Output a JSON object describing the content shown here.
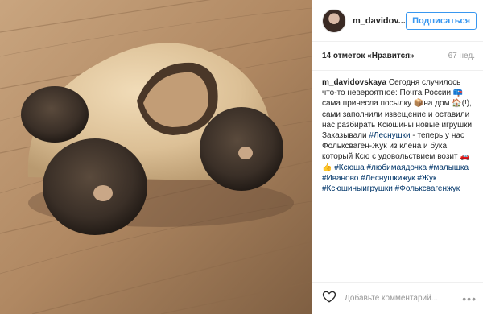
{
  "post": {
    "image_alt": "wooden toy car",
    "username": "m_davidov...",
    "follow_label": "Подписаться",
    "likes": "14 отметок «Нравится»",
    "time": "67 нед.",
    "caption": {
      "author": "m_davidovskaya",
      "parts": [
        {
          "type": "text",
          "value": " Сегодня случилось что-то невероятное: Почта России "
        },
        {
          "type": "emoji",
          "value": "📪"
        },
        {
          "type": "text",
          "value": "сама принесла посылку "
        },
        {
          "type": "emoji",
          "value": "📦"
        },
        {
          "type": "text",
          "value": "на дом "
        },
        {
          "type": "emoji",
          "value": "🏠"
        },
        {
          "type": "text",
          "value": "(!), сами заполнили извещение и оставили нас разбирать Ксюшины новые игрушки. Заказывали "
        },
        {
          "type": "tag",
          "value": "#Леснушки"
        },
        {
          "type": "text",
          "value": " - теперь у нас Фольксваген-Жук из клена и бука, который Ксю с удовольствием возит "
        },
        {
          "type": "emoji",
          "value": "🚗"
        },
        {
          "type": "text",
          "value": " "
        },
        {
          "type": "emoji",
          "value": "👍"
        },
        {
          "type": "text",
          "value": " "
        },
        {
          "type": "tag",
          "value": "#Ксюша"
        },
        {
          "type": "text",
          "value": " "
        },
        {
          "type": "tag",
          "value": "#любимаядочка"
        },
        {
          "type": "text",
          "value": " "
        },
        {
          "type": "tag",
          "value": "#малышка"
        },
        {
          "type": "text",
          "value": " "
        },
        {
          "type": "tag",
          "value": "#Иваново"
        },
        {
          "type": "text",
          "value": " "
        },
        {
          "type": "tag",
          "value": "#Леснушкижук"
        },
        {
          "type": "text",
          "value": " "
        },
        {
          "type": "tag",
          "value": "#Жук"
        },
        {
          "type": "text",
          "value": " "
        },
        {
          "type": "tag",
          "value": "#Ксюшиныигрушки"
        },
        {
          "type": "text",
          "value": " "
        },
        {
          "type": "tag",
          "value": "#Фольксвагенжук"
        }
      ]
    },
    "comment_placeholder": "Добавьте комментарий...",
    "more_icon": "more-dots-icon",
    "heart_icon": "heart-icon",
    "colors": {
      "accent": "#3897f0",
      "hashtag": "#003569",
      "muted": "#999999"
    }
  }
}
